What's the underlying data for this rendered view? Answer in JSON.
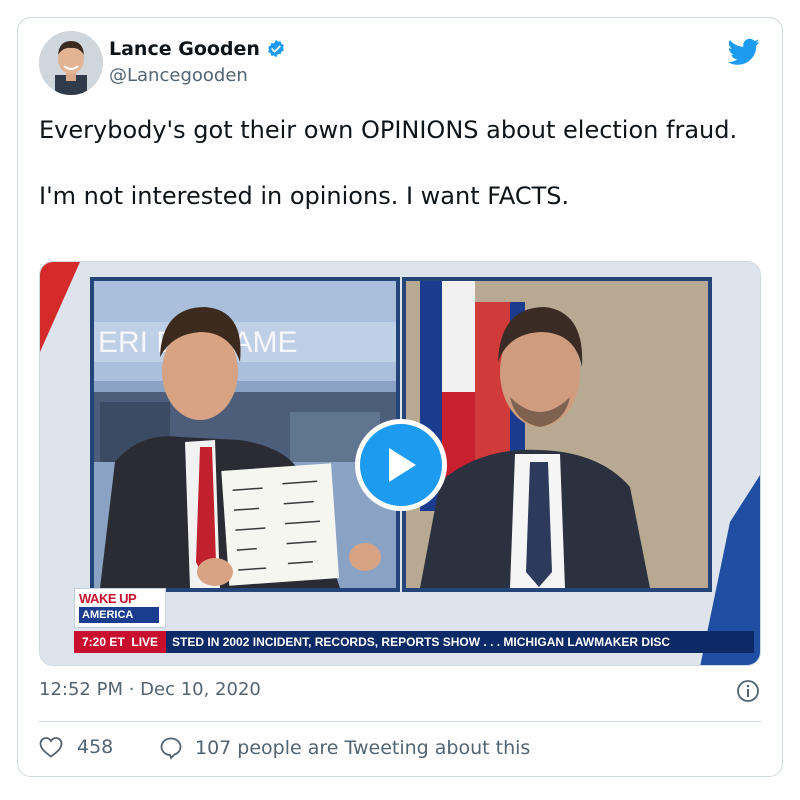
{
  "author": {
    "name": "Lance Gooden",
    "handle": "@Lancegooden"
  },
  "tweet": {
    "text": "Everybody's got their own OPINIONS about election fraud.\n\nI'm not interested in opinions. I want FACTS."
  },
  "media": {
    "type": "video",
    "background_text": "ERI  E UP AME",
    "show_logo_line1": "WAKE UP",
    "show_logo_line2": "AMERICA",
    "ticker_time": "7:20 ET",
    "ticker_live": "LIVE",
    "ticker_text": "STED IN 2002 INCIDENT, RECORDS, REPORTS SHOW . . .      MICHIGAN LAWMAKER DISC"
  },
  "meta": {
    "timestamp": "12:52 PM · Dec 10, 2020"
  },
  "actions": {
    "likes": "458",
    "conversation": "107 people are Tweeting about this"
  },
  "colors": {
    "accent": "#1d9bf0",
    "secondary_text": "#536471",
    "like_icon": "#536471"
  },
  "icons": {
    "verified": "verified-badge-icon",
    "twitter": "twitter-bird-icon",
    "play": "play-icon",
    "info": "info-icon",
    "like": "heart-icon",
    "reply": "speech-bubble-icon"
  }
}
